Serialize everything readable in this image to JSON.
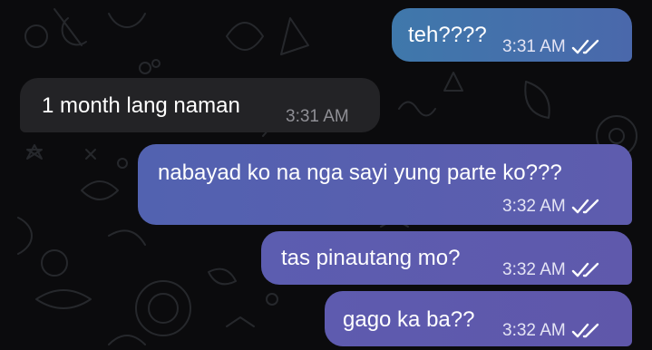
{
  "conversation": {
    "messages": [
      {
        "direction": "outgoing",
        "text": "teh????",
        "time": "3:31 AM",
        "status_icon": "double-check-icon",
        "color": "#3f74a8"
      },
      {
        "direction": "incoming",
        "text": "1 month lang naman",
        "time": "3:31 AM"
      },
      {
        "direction": "outgoing",
        "text": "nabayad ko na nga sayi yung parte ko???",
        "time": "3:32 AM",
        "status_icon": "double-check-icon",
        "color": "#5b5fb0"
      },
      {
        "direction": "outgoing",
        "text": "tas pinautang mo?",
        "time": "3:32 AM",
        "status_icon": "double-check-icon",
        "color": "#5e5aac"
      },
      {
        "direction": "outgoing",
        "text": "gago ka ba??",
        "time": "3:32 AM",
        "status_icon": "double-check-icon",
        "color": "#5f58aa"
      }
    ]
  },
  "theme": {
    "background": "#0b0b0d",
    "incoming_bubble": "#232326",
    "outgoing_gradient_start": "#3f74a8",
    "outgoing_gradient_end": "#5e57aa"
  }
}
